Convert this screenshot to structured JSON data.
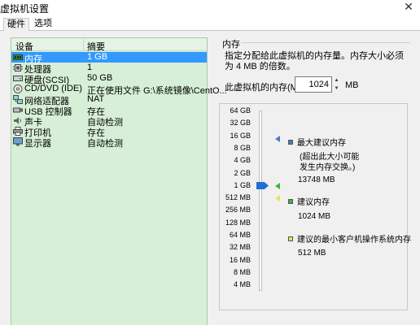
{
  "window": {
    "title": "虚拟机设置",
    "close_glyph": "✕"
  },
  "tabs": [
    {
      "label": "硬件"
    },
    {
      "label": "选项"
    }
  ],
  "device_list": {
    "headers": {
      "device": "设备",
      "summary": "摘要"
    },
    "rows": [
      {
        "icon": "memory-icon",
        "name": "内存",
        "summary": "1 GB",
        "selected": true
      },
      {
        "icon": "cpu-icon",
        "name": "处理器",
        "summary": "1"
      },
      {
        "icon": "hard-disk-icon",
        "name": "硬盘(SCSI)",
        "summary": "50 GB"
      },
      {
        "icon": "cd-dvd-icon",
        "name": "CD/DVD (IDE)",
        "summary": "正在使用文件 G:\\系统镜像\\CentO..."
      },
      {
        "icon": "network-adapter-icon",
        "name": "网络适配器",
        "summary": "NAT"
      },
      {
        "icon": "usb-controller-icon",
        "name": "USB 控制器",
        "summary": "存在"
      },
      {
        "icon": "sound-card-icon",
        "name": "声卡",
        "summary": "自动检测"
      },
      {
        "icon": "printer-icon",
        "name": "打印机",
        "summary": "存在"
      },
      {
        "icon": "display-icon",
        "name": "显示器",
        "summary": "自动检测"
      }
    ]
  },
  "memory": {
    "group_title": "内存",
    "description": "指定分配给此虚拟机的内存量。内存大小必须为 4 MB 的倍数。",
    "field_label": "此虚拟机的内存(M):",
    "value": "1024",
    "unit": "MB",
    "scale_labels": [
      "64 GB",
      "32 GB",
      "16 GB",
      "8 GB",
      "4 GB",
      "2 GB",
      "1 GB",
      "512 MB",
      "256 MB",
      "128 MB",
      "64 MB",
      "32 MB",
      "16 MB",
      "8 MB",
      "4 MB"
    ],
    "legend": {
      "max_recommended": {
        "title": "最大建议内存",
        "note": "(超出此大小可能发生内存交换。)",
        "value": "13748 MB",
        "color": "#4a7ebb"
      },
      "recommended": {
        "title": "建议内存",
        "value": "1024 MB",
        "color": "#3cb43c"
      },
      "min_recommended": {
        "title": "建议的最小客户机操作系统内存",
        "value": "512 MB",
        "color": "#e6e64a"
      }
    }
  }
}
